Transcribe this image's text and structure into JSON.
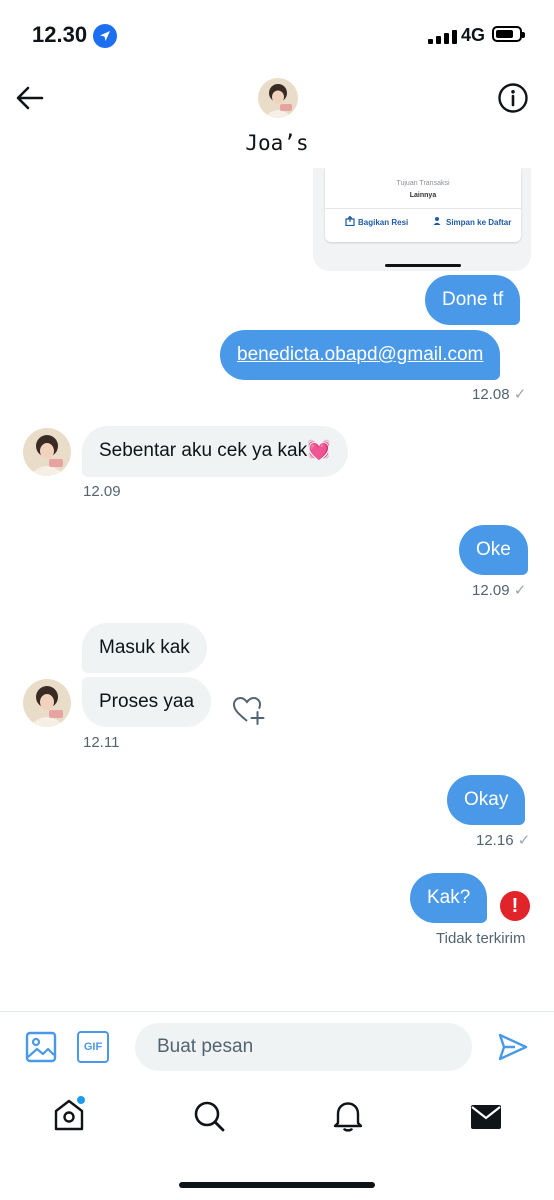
{
  "status_bar": {
    "time": "12.30",
    "network": "4G",
    "icons": [
      "location-arrow-icon",
      "signal-bars-icon",
      "battery-icon"
    ]
  },
  "header": {
    "name": "Joa’s",
    "icons": [
      "back-arrow-icon",
      "info-icon"
    ]
  },
  "receipt_preview": {
    "label": "Tujuan Transaksi",
    "value": "Lainnya",
    "share_label": "Bagikan Resi",
    "save_label": "Simpan ke Daftar"
  },
  "messages": {
    "m1": "Done tf",
    "m2": "benedicta.obapd@gmail.com",
    "m2_time": "12.08",
    "m3": "Sebentar aku cek ya kak💓",
    "m3_time": "12.09",
    "m4": "Oke",
    "m4_time": "12.09",
    "m5": "Masuk kak",
    "m6": "Proses yaa",
    "m6_time": "12.11",
    "m7": "Okay",
    "m7_time": "12.16",
    "m8": "Kak?",
    "m8_status": "Tidak terkirim",
    "check_mark": "✓",
    "error_mark": "!"
  },
  "composer": {
    "placeholder": "Buat pesan",
    "gif_label": "GIF"
  },
  "colors": {
    "accent": "#4a99e9",
    "received_bubble": "#eff3f4",
    "error": "#e0242a",
    "meta_text": "#536471"
  },
  "tab_bar": {
    "icons": [
      "home-icon",
      "search-icon",
      "notifications-bell-icon",
      "messages-envelope-icon"
    ]
  }
}
